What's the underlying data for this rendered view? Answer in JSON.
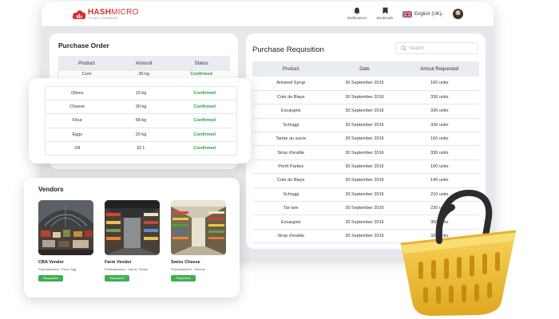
{
  "brand": {
    "name_part1": "HASH",
    "name_part2": "MICRO",
    "tagline": "THINK FORWARD",
    "color": "#d62d2d"
  },
  "header": {
    "notifications_label": "Notifications",
    "bookmark_label": "Bookmark",
    "language": "English (UK)",
    "icons": [
      "bell-icon",
      "bookmark-icon",
      "uk-flag-icon",
      "chevron-down-icon",
      "avatar"
    ]
  },
  "purchase_order": {
    "title": "Purchase Order",
    "columns": [
      "Product",
      "Amount",
      "Status"
    ],
    "rows": [
      {
        "product": "Corn",
        "amount": "30 kg",
        "status": "Confirmed"
      }
    ],
    "popout_rows": [
      {
        "product": "Olives",
        "amount": "10 kg",
        "status": "Confirmed"
      },
      {
        "product": "Cheese",
        "amount": "30 kg",
        "status": "Confirmed"
      },
      {
        "product": "Flour",
        "amount": "68 kg",
        "status": "Confirmed"
      },
      {
        "product": "Eggs",
        "amount": "20 kg",
        "status": "Confirmed"
      },
      {
        "product": "Oil",
        "amount": "32 L",
        "status": "Confirmed"
      }
    ],
    "status_color": "#2f9a47"
  },
  "purchase_requisition": {
    "title": "Purchase Requisition",
    "search_placeholder": "Search",
    "columns": [
      "Product",
      "Date",
      "Amout Requested"
    ],
    "rows": [
      {
        "product": "Aniseed Syrup",
        "date": "30 September 2016",
        "amount": "160 units"
      },
      {
        "product": "Cote de Blaye",
        "date": "30 September 2016",
        "amount": "336 units"
      },
      {
        "product": "Escargots",
        "date": "30 September 2016",
        "amount": "336 units"
      },
      {
        "product": "Schoggi",
        "date": "30 September 2016",
        "amount": "336 units"
      },
      {
        "product": "Tartae au sucre",
        "date": "30 September 2016",
        "amount": "160 units"
      },
      {
        "product": "Sirop d'erable",
        "date": "30 September 2016",
        "amount": "336 units"
      },
      {
        "product": "Perth Parties",
        "date": "30 September 2016",
        "amount": "160 units"
      },
      {
        "product": "Cote de Blaye",
        "date": "30 September 2016",
        "amount": "140 units"
      },
      {
        "product": "Schoggi",
        "date": "30 September 2016",
        "amount": "210 units"
      },
      {
        "product": "Tar tare",
        "date": "30 September 2016",
        "amount": "230 units"
      },
      {
        "product": "Escargots",
        "date": "30 September 2016",
        "amount": "360 units"
      },
      {
        "product": "Sirop d'erable",
        "date": "30 September 2016",
        "amount": "336 units"
      }
    ]
  },
  "vendors": {
    "title": "Vendors",
    "items": [
      {
        "name": "CBA Vendor",
        "purchasement": "Purchasement : Flour, Egg",
        "badge": "Requested"
      },
      {
        "name": "Farm Vendor",
        "purchasement": "Purchasement : Carrot, Potato",
        "badge": "Requested"
      },
      {
        "name": "Swiss Cheese",
        "purchasement": "Purchasement : Cheese",
        "badge": "Requested"
      }
    ],
    "badge_color": "#3fae50"
  },
  "decoration": {
    "basket_color": "#f3c13a",
    "basket_icon": "shopping-basket-icon"
  }
}
